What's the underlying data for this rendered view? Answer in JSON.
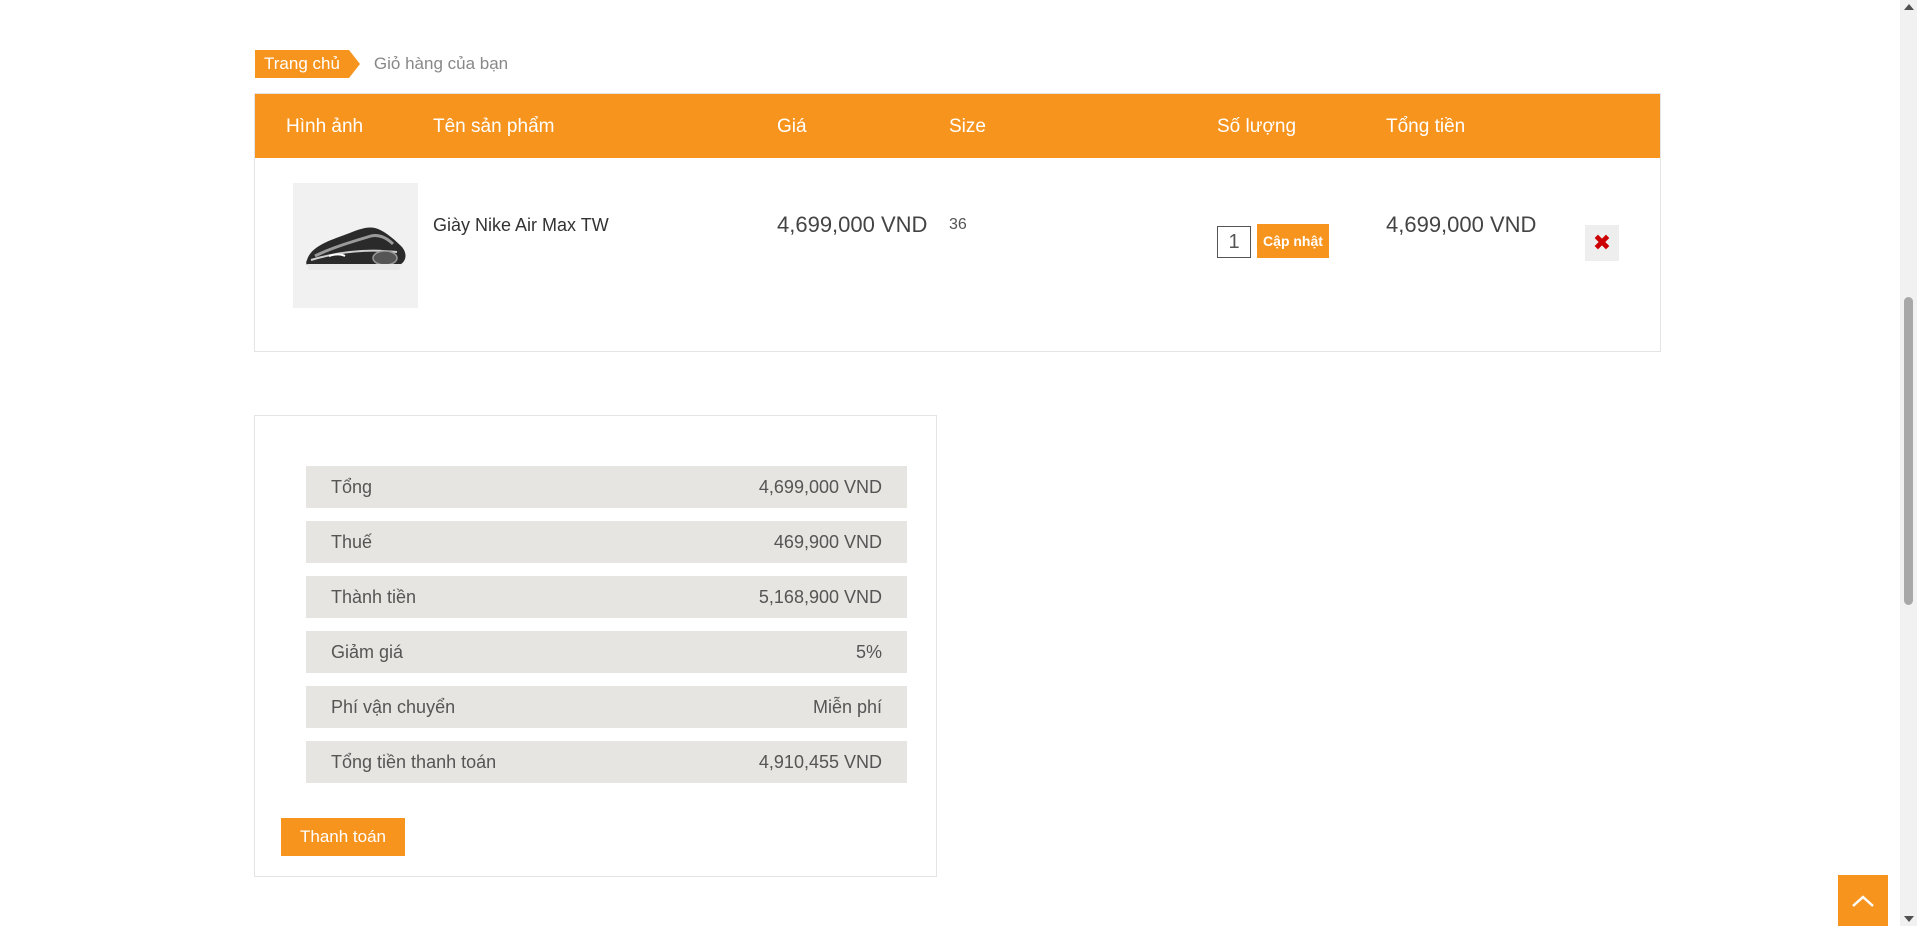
{
  "breadcrumb": {
    "home": "Trang chủ",
    "current": "Giỏ hàng của bạn"
  },
  "cart": {
    "headers": {
      "image": "Hình ảnh",
      "name": "Tên sản phẩm",
      "price": "Giá",
      "size": "Size",
      "quantity": "Số lượng",
      "total": "Tổng tiền"
    },
    "items": [
      {
        "name": "Giày Nike Air Max TW",
        "price": "4,699,000 VND",
        "size": "36",
        "quantity": "1",
        "total": "4,699,000 VND",
        "update_label": "Cập nhật",
        "remove_icon": "close-icon"
      }
    ]
  },
  "summary": {
    "rows": [
      {
        "label": "Tổng",
        "value": "4,699,000 VND"
      },
      {
        "label": "Thuế",
        "value": "469,900 VND"
      },
      {
        "label": "Thành tiền",
        "value": "5,168,900 VND"
      },
      {
        "label": "Giảm giá",
        "value": "5%"
      },
      {
        "label": "Phí vận chuyển",
        "value": "Miễn phí"
      },
      {
        "label": "Tổng tiền thanh toán",
        "value": "4,910,455 VND"
      }
    ],
    "checkout_label": "Thanh toán"
  },
  "colors": {
    "accent": "#f7941d",
    "summary_row_bg": "#e6e5e1",
    "remove_icon": "#cc0000"
  },
  "icons": {
    "scroll_top": "chevron-up-icon"
  }
}
